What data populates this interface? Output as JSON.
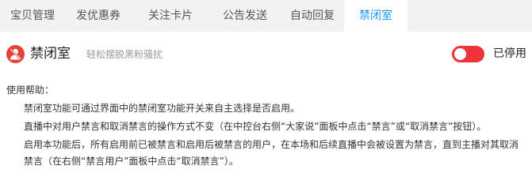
{
  "tabs": [
    {
      "label": "宝贝管理",
      "active": false
    },
    {
      "label": "发优惠券",
      "active": false
    },
    {
      "label": "关注卡片",
      "active": false
    },
    {
      "label": "公告发送",
      "active": false
    },
    {
      "label": "自动回复",
      "active": false
    },
    {
      "label": "禁闭室",
      "active": true
    }
  ],
  "feature": {
    "icon": "person-ban-icon",
    "title": "禁闭室",
    "subtitle": "轻松摆脱黑粉骚扰",
    "toggle_state": "on",
    "toggle_label": "已停用",
    "toggle_color": "#f0323a"
  },
  "help": {
    "title": "使用帮助：",
    "items": [
      "禁闭室功能可通过界面中的禁闭室功能开关来自主选择是否启用。",
      "直播中对用户禁言和取消禁言的操作方式不变（在中控台右侧“大家说”面板中点击“禁言”或“取消禁言”按钮）。",
      "启用本功能后，所有启用前已被禁言和启用后被禁言的用户，在本场和后续直播中会被设置为禁言，直到主播对其取消禁言（在右侧“禁言用户”面板中点击“取消禁言”）。"
    ]
  },
  "colors": {
    "accent": "#1a98ff",
    "danger": "#e8413c"
  }
}
